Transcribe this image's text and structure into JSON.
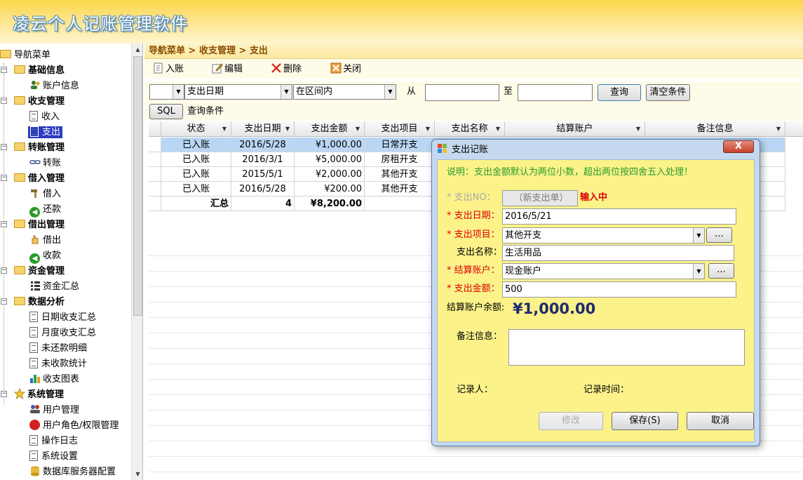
{
  "app": {
    "title": "凌云个人记账管理软件"
  },
  "sidebar": {
    "root": "导航菜单",
    "groups": [
      {
        "label": "基础信息",
        "items": [
          "账户信息"
        ]
      },
      {
        "label": "收支管理",
        "items": [
          "收入",
          "支出"
        ]
      },
      {
        "label": "转账管理",
        "items": [
          "转账"
        ]
      },
      {
        "label": "借入管理",
        "items": [
          "借入",
          "还款"
        ]
      },
      {
        "label": "借出管理",
        "items": [
          "借出",
          "收款"
        ]
      },
      {
        "label": "资金管理",
        "items": [
          "资金汇总"
        ]
      },
      {
        "label": "数据分析",
        "items": [
          "日期收支汇总",
          "月度收支汇总",
          "未还款明细",
          "未收款统计",
          "收支图表"
        ]
      },
      {
        "label": "系统管理",
        "items": [
          "用户管理",
          "用户角色/权限管理",
          "操作日志",
          "系统设置",
          "数据库服务器配置"
        ]
      }
    ],
    "selected": "支出"
  },
  "breadcrumb": "导航菜单 > 收支管理 > 支出",
  "toolbar": {
    "add": "入账",
    "edit": "编辑",
    "delete": "删除",
    "close": "关闭"
  },
  "filter": {
    "field_label": "支出日期",
    "condition": "在区间内",
    "from_label": "从",
    "to_label": "至",
    "from_value": "",
    "to_value": "",
    "query_btn": "查询",
    "clear_btn": "清空条件",
    "sql_btn": "SQL",
    "sql_label": "查询条件"
  },
  "grid": {
    "columns": [
      "状态",
      "支出日期",
      "支出金额",
      "支出项目",
      "支出名称",
      "结算账户",
      "备注信息"
    ],
    "rows": [
      [
        "已入账",
        "2016/5/28",
        "¥1,000.00",
        "日常开支"
      ],
      [
        "已入账",
        "2016/3/1",
        "¥5,000.00",
        "房租开支"
      ],
      [
        "已入账",
        "2015/5/1",
        "¥2,000.00",
        "其他开支"
      ],
      [
        "已入账",
        "2016/5/28",
        "¥200.00",
        "其他开支"
      ]
    ],
    "total": {
      "label": "汇总",
      "count": "4",
      "amount": "¥8,200.00"
    }
  },
  "dialog": {
    "title": "支出记账",
    "close": "X",
    "note": "说明：支出金额默认为两位小数，超出两位按四舍五入处理！",
    "no_label": "* 支出NO：",
    "no_value": "（新支出单）",
    "status": "输入中",
    "date_label": "* 支出日期：",
    "date_value": "2016/5/21",
    "item_label": "* 支出项目：",
    "item_value": "其他开支",
    "name_label": "支出名称：",
    "name_value": "生活用品",
    "account_label": "* 结算账户：",
    "account_value": "现金账户",
    "amount_label": "* 支出金额：",
    "amount_value": "500",
    "balance_label": "结算账户余额:",
    "balance_value": "¥1,000.00",
    "memo_label": "备注信息：",
    "recorder_label": "记录人：",
    "time_label": "记录时间：",
    "more_btn": "...",
    "edit_btn": "修改",
    "save_btn": "保存(S)",
    "cancel_btn": "取消"
  }
}
